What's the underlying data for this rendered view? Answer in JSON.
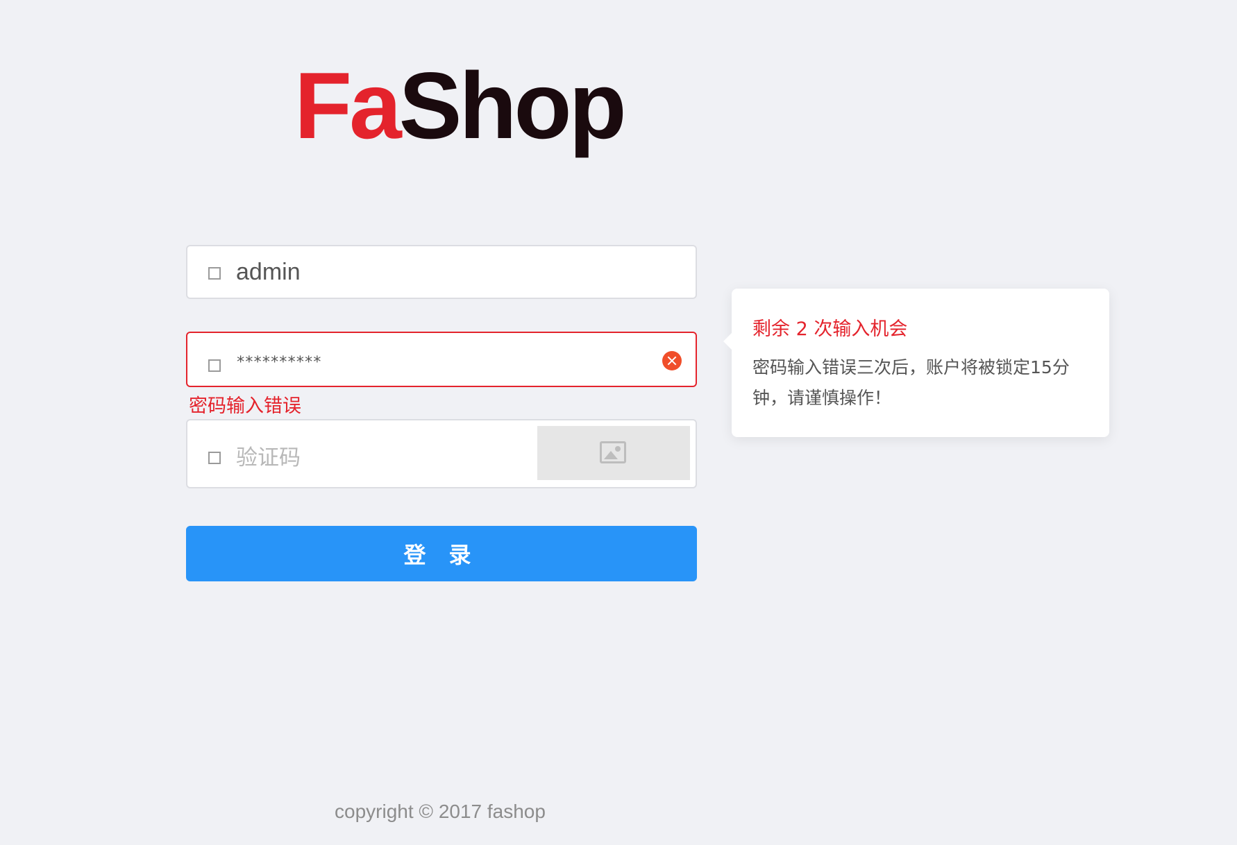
{
  "logo": {
    "part1": "Fa",
    "part2": "Shop"
  },
  "username": {
    "icon": "user-icon",
    "value": "admin"
  },
  "password": {
    "icon": "lock-icon",
    "value": "**********",
    "clear_icon": "clear-icon"
  },
  "password_error": "密码输入错误",
  "captcha": {
    "icon": "shield-icon",
    "placeholder": "验证码",
    "image_icon": "image-placeholder-icon"
  },
  "login_button": "登 录",
  "tooltip": {
    "title": "剩余 2 次输入机会",
    "body": "密码输入错误三次后，账户将被锁定15分钟，请谨慎操作！"
  },
  "footer": {
    "copyright": "copyright © 2017 fashop"
  },
  "colors": {
    "accent": "#2894f8",
    "error": "#e4232c",
    "background": "#f0f1f5"
  }
}
